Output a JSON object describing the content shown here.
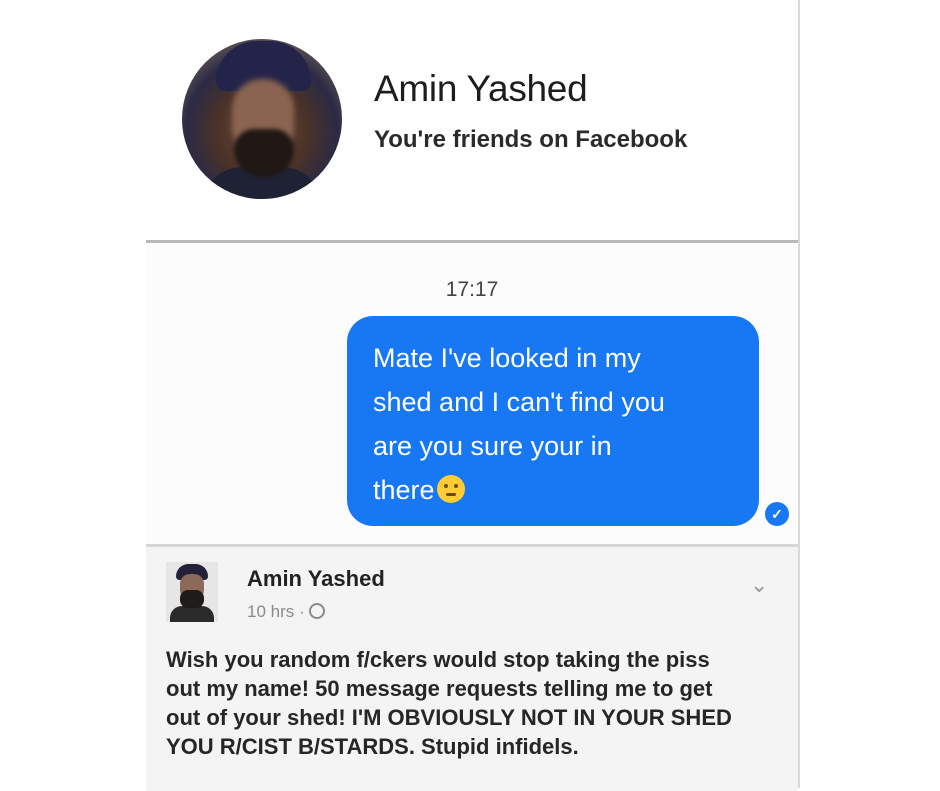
{
  "header": {
    "contact_name": "Amin Yashed",
    "friend_status": "You're friends on Facebook"
  },
  "conversation": {
    "timestamp": "17:17",
    "message_lines": [
      "Mate I've looked in my",
      "shed and I can't find you",
      "are you sure your in",
      "there"
    ],
    "message_emoji": "thinking-face-emoji",
    "read_receipt_icon": "checkmark-circle-icon",
    "bubble_color": "#1877f2"
  },
  "post": {
    "author": "Amin Yashed",
    "time": "10 hrs ·",
    "privacy_icon": "globe-icon",
    "menu_icon": "chevron-down-icon",
    "body_lines": [
      "Wish you random f/ckers would stop taking the piss",
      "out my name! 50 message requests telling me to get",
      "out of your shed! I'M OBVIOUSLY NOT IN YOUR SHED",
      "YOU R/CIST B/STARDS. Stupid infidels."
    ]
  }
}
